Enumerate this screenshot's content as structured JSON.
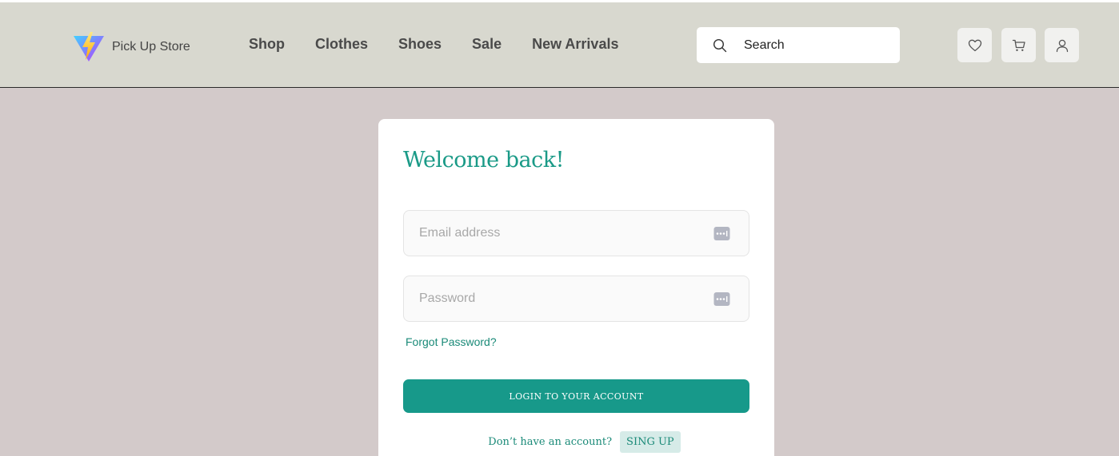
{
  "header": {
    "brand_name": "Pick Up Store",
    "nav": [
      "Shop",
      "Clothes",
      "Shoes",
      "Sale",
      "New Arrivals"
    ],
    "search_placeholder": "Search",
    "icons": [
      "heart-icon",
      "cart-icon",
      "user-icon"
    ]
  },
  "login": {
    "title": "Welcome back!",
    "email_placeholder": "Email address",
    "password_placeholder": "Password",
    "forgot_label": "Forgot Password?",
    "submit_label": "LOGIN TO YOUR ACCOUNT",
    "signup_prompt": "Don’t have an account?",
    "signup_label": "SING UP"
  },
  "colors": {
    "accent": "#17998a",
    "header_bg": "#d8d8cf",
    "page_bg": "#d3caca"
  }
}
